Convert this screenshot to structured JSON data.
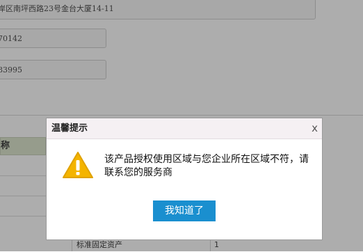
{
  "form": {
    "address_value": "岸区南坪西路23号金台大厦14-11",
    "field2_value": "70142",
    "field3_value": "83995"
  },
  "table": {
    "header_label": "称",
    "bottom_row": {
      "label": "标准固定资产",
      "value": "1"
    }
  },
  "dialog": {
    "title": "温馨提示",
    "close_glyph": "x",
    "message": "该产品授权使用区域与您企业所在区域不符，请联系您的服务商",
    "ok_label": "我知道了",
    "icon": "warning-icon"
  },
  "colors": {
    "overlay": "#6b6b6b",
    "button": "#1a8fcf",
    "warning": "#f4b400",
    "table_header": "#d7e2c6"
  }
}
